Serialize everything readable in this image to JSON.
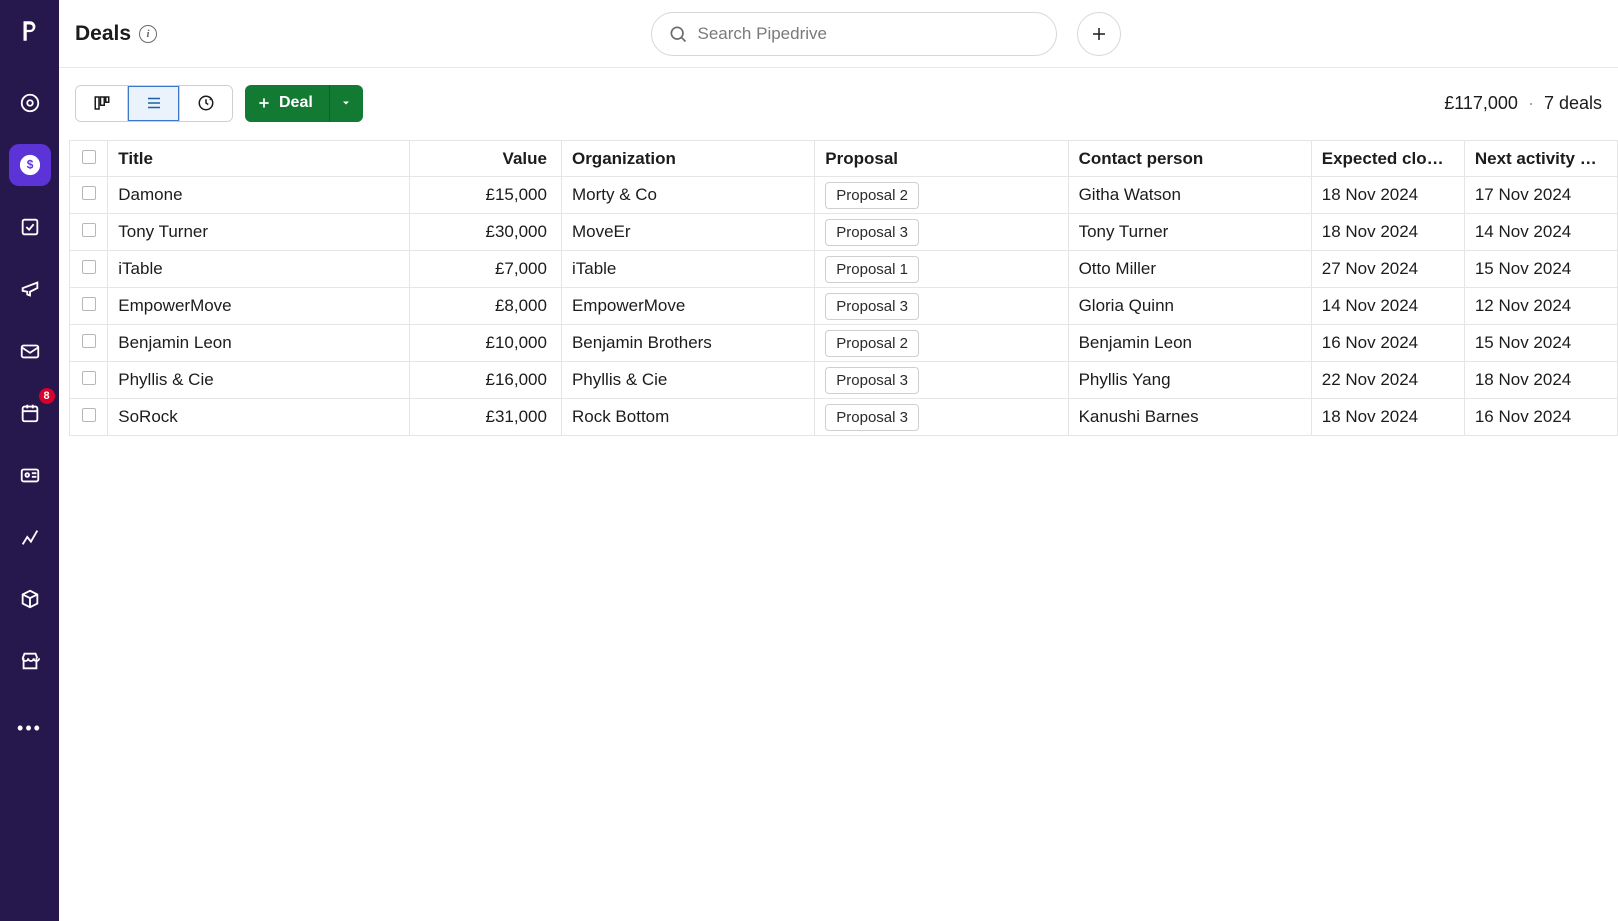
{
  "sidebar": {
    "badge": "8"
  },
  "header": {
    "title": "Deals",
    "search_placeholder": "Search Pipedrive"
  },
  "toolbar": {
    "deal_label": "Deal",
    "summary_value": "£117,000",
    "summary_count": "7 deals"
  },
  "table": {
    "columns": {
      "title": "Title",
      "value": "Value",
      "organization": "Organization",
      "proposal": "Proposal",
      "contact": "Contact person",
      "expected_close": "Expected clo…",
      "next_activity": "Next activity …"
    },
    "rows": [
      {
        "title": "Damone",
        "value": "£15,000",
        "organization": "Morty & Co",
        "proposal": "Proposal 2",
        "contact": "Githa Watson",
        "expected_close": "18 Nov 2024",
        "next_activity": "17 Nov 2024"
      },
      {
        "title": "Tony Turner",
        "value": "£30,000",
        "organization": "MoveEr",
        "proposal": "Proposal 3",
        "contact": "Tony Turner",
        "expected_close": "18 Nov 2024",
        "next_activity": "14 Nov 2024"
      },
      {
        "title": "iTable",
        "value": "£7,000",
        "organization": "iTable",
        "proposal": "Proposal 1",
        "contact": "Otto Miller",
        "expected_close": "27 Nov 2024",
        "next_activity": "15 Nov 2024"
      },
      {
        "title": "EmpowerMove",
        "value": "£8,000",
        "organization": "EmpowerMove",
        "proposal": "Proposal 3",
        "contact": "Gloria Quinn",
        "expected_close": "14 Nov 2024",
        "next_activity": "12 Nov 2024"
      },
      {
        "title": "Benjamin Leon",
        "value": "£10,000",
        "organization": "Benjamin Brothers",
        "proposal": "Proposal 2",
        "contact": "Benjamin Leon",
        "expected_close": "16 Nov 2024",
        "next_activity": "15 Nov 2024"
      },
      {
        "title": "Phyllis & Cie",
        "value": "£16,000",
        "organization": "Phyllis & Cie",
        "proposal": "Proposal 3",
        "contact": "Phyllis Yang",
        "expected_close": "22 Nov 2024",
        "next_activity": "18 Nov 2024"
      },
      {
        "title": "SoRock",
        "value": "£31,000",
        "organization": "Rock Bottom",
        "proposal": "Proposal 3",
        "contact": "Kanushi Barnes",
        "expected_close": "18 Nov 2024",
        "next_activity": "16 Nov 2024"
      }
    ]
  }
}
